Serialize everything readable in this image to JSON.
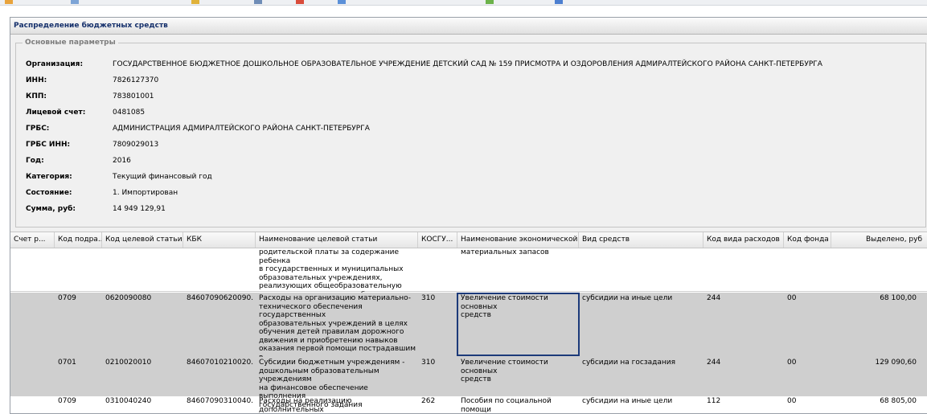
{
  "window": {
    "title": "Распределение бюджетных средств"
  },
  "main_params": {
    "legend": "Основные параметры",
    "fields": [
      {
        "label": "Организация:",
        "value": "ГОСУДАРСТВЕННОЕ БЮДЖЕТНОЕ ДОШКОЛЬНОЕ ОБРАЗОВАТЕЛЬНОЕ УЧРЕЖДЕНИЕ ДЕТСКИЙ САД № 159 ПРИСМОТРА И ОЗДОРОВЛЕНИЯ АДМИРАЛТЕЙСКОГО РАЙОНА САНКТ-ПЕТЕРБУРГА"
      },
      {
        "label": "ИНН:",
        "value": "7826127370"
      },
      {
        "label": "КПП:",
        "value": "783801001"
      },
      {
        "label": "Лицевой счет:",
        "value": "0481085"
      },
      {
        "label": "ГРБС:",
        "value": "АДМИНИСТРАЦИЯ АДМИРАЛТЕЙСКОГО РАЙОНА САНКТ-ПЕТЕРБУРГА"
      },
      {
        "label": "ГРБС ИНН:",
        "value": "7809029013"
      },
      {
        "label": "Год:",
        "value": "2016"
      },
      {
        "label": "Категория:",
        "value": "Текущий финансовый год"
      },
      {
        "label": "Состояние:",
        "value": "1. Импортирован"
      },
      {
        "label": "Сумма, руб:",
        "value": "14 949 129,91"
      }
    ]
  },
  "grid": {
    "columns": [
      "Счет р...",
      "Код подра...",
      "Код целевой статьи",
      "КБК",
      "Наименование целевой статьи",
      "КОСГУ...",
      "Наименование экономической ...",
      "Вид средств",
      "Код вида расходов",
      "Код фонда",
      "Выделено, руб"
    ],
    "rows": [
      {
        "cells": [
          "",
          "",
          "",
          "",
          "родительской платы за содержание ребенка\nв государственных и муниципальных\nобразовательных учреждениях,\nреализующих общеобразовательную\nпрограмму дошкольного образования",
          "",
          "материальных запасов",
          "",
          "",
          "",
          ""
        ],
        "selected": false
      },
      {
        "cells": [
          "",
          "0709",
          "0620090080",
          "84607090620090...",
          "Расходы на организацию материально-\nтехнического обеспечения государственных\nобразовательных учреждений в целях\nобучения детей правилам дорожного\nдвижения и приобретению навыков\nоказания первой помощи пострадавшим в\nДТП",
          "310",
          "Увеличение стоимости основных\nсредств",
          "субсидии на иные цели",
          "244",
          "00",
          "68 100,00"
        ],
        "selected": true
      },
      {
        "cells": [
          "",
          "0701",
          "0210020010",
          "84607010210020...",
          "Субсидии бюджетным учреждениям -\nдошкольным образовательным учреждениям\nна финансовое обеспечение выполнения\nгосударственного задания",
          "310",
          "Увеличение стоимости основных\nсредств",
          "субсидии на госзадания",
          "244",
          "00",
          "129 090,60"
        ],
        "selected": true
      },
      {
        "cells": [
          "",
          "0709",
          "0310040240",
          "84607090310040...",
          "Расходы на реализацию дополнительных\nмер социальной поддержки работникам",
          "262",
          "Пособия по социальной помощи\nнаселению",
          "субсидии на иные цели",
          "112",
          "00",
          "68 805,00"
        ],
        "selected": false
      }
    ]
  }
}
